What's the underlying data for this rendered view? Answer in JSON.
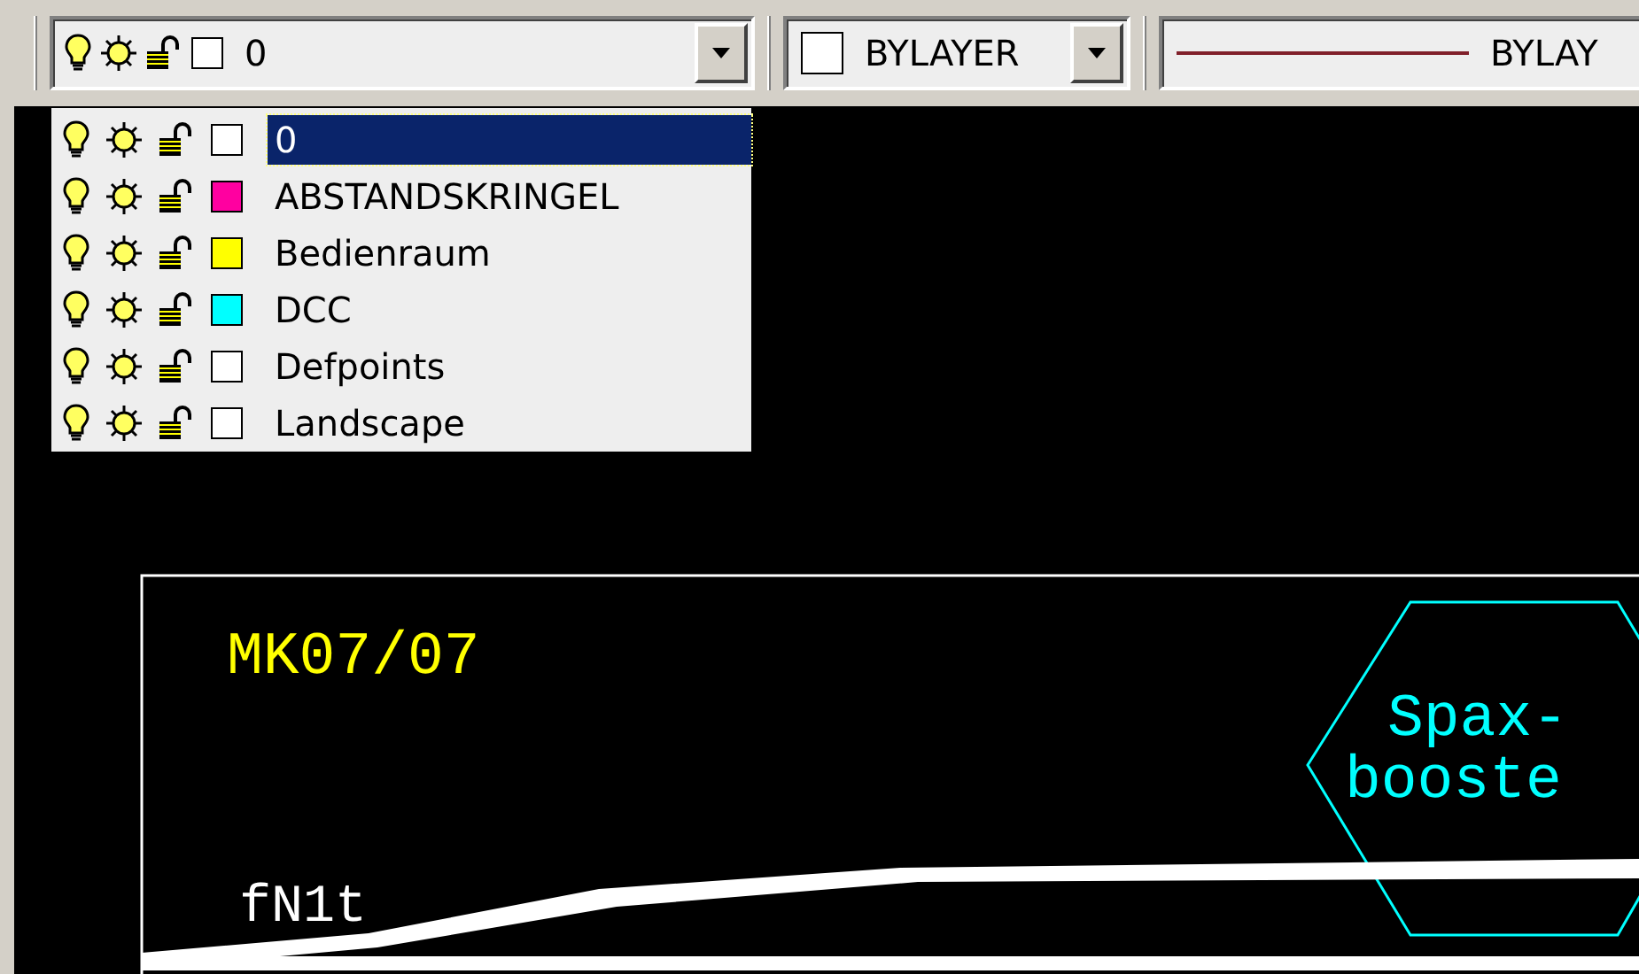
{
  "toolbar": {
    "layer_combo": {
      "value": "0",
      "color": "#ffffff"
    },
    "color_combo": {
      "value": "BYLAYER",
      "color": "#ffffff"
    },
    "linetype_combo": {
      "value": "BYLAY"
    }
  },
  "layer_list": [
    {
      "name": "0",
      "color": "#ffffff",
      "selected": true
    },
    {
      "name": "ABSTANDSKRINGEL",
      "color": "#ff00a0",
      "selected": false
    },
    {
      "name": "Bedienraum",
      "color": "#ffff00",
      "selected": false
    },
    {
      "name": "DCC",
      "color": "#00ffff",
      "selected": false
    },
    {
      "name": "Defpoints",
      "color": "#ffffff",
      "selected": false
    },
    {
      "name": "Landscape",
      "color": "#ffffff",
      "selected": false
    }
  ],
  "drawing": {
    "texts": [
      {
        "kind": "title",
        "text": "MK07/07",
        "color": "#ffff00"
      },
      {
        "kind": "label",
        "text": "fN1t",
        "color": "#ffffff"
      },
      {
        "kind": "hex1",
        "text": "Spax-",
        "color": "#00ffff"
      },
      {
        "kind": "hex2",
        "text": "booste",
        "color": "#00ffff"
      }
    ]
  }
}
